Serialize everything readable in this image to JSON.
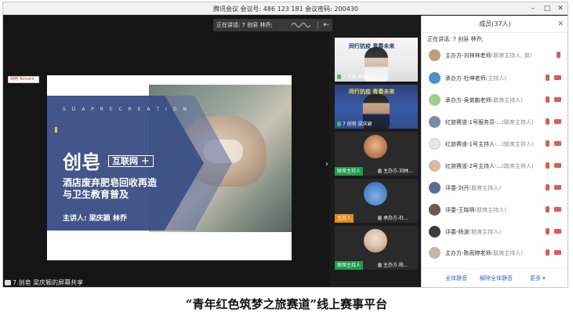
{
  "window": {
    "title": "腾讯会议 会议号: 486 123 181  会议密码: 200430",
    "controls": [
      "–",
      "□",
      "✕"
    ]
  },
  "stage": {
    "speaking": "正在讲话: 7 创皂 林乔;",
    "exit_icon": "exit-icon",
    "mini_logo": "网络 Tencent",
    "share_label": "7.创皂 梁庆颖的屏幕共享"
  },
  "slide": {
    "ribbon": "S D A P R E C R E A T I O N",
    "title": "创皂",
    "tag": "互联网 ＋",
    "subtitle_line1": "酒店废弃肥皂回收再造",
    "subtitle_line2": "与卫生教育普及",
    "speaker": "主讲人: 梁庆颖   林乔",
    "accent_color": "#3a4f86"
  },
  "tiles": [
    {
      "banner": "同行抗疫  青春未来",
      "label": "7 创皂 林乔",
      "mic": "on"
    },
    {
      "banner": "同行抗疫  青春未来",
      "label": "7 创皂 梁庆颖",
      "mic": "on"
    },
    {
      "badge": "联席主持人",
      "badge_color": "green",
      "label": "主办方-刘林...",
      "mic": "off"
    },
    {
      "badge": "主持人",
      "badge_color": "orange",
      "label": "承办方-杜...",
      "mic": "off"
    },
    {
      "badge": "联席主持人",
      "badge_color": "green",
      "label": "主办方-陈...",
      "mic": "off"
    }
  ],
  "sidebar": {
    "title": "成员(37人)",
    "speaking": "正在讲话: 7 创皂 林乔;",
    "members": [
      {
        "name": "主办方-刘林林老师",
        "role": "(联席主持人, 我)",
        "color": "#b9a27a"
      },
      {
        "name": "承办方-杜坤老师",
        "role": "(主持人)",
        "color": "#4f8ed1"
      },
      {
        "name": "承办方-吴弟鹏老师",
        "role": "(联席主持人)",
        "color": "#9fd08a"
      },
      {
        "name": "红旅赛道-1号服务员-...",
        "role": "(联席主持人)",
        "color": "#7b8aa8"
      },
      {
        "name": "红旅赛道-1号主持人-...",
        "role": "(联席主持人)",
        "color": "#e6e6e6"
      },
      {
        "name": "红旅赛道-2号主持人-...",
        "role": "(联席主持人)",
        "color": "#d9b99f"
      },
      {
        "name": "评委-刘丹",
        "role": "(联席主持人)",
        "color": "#5c6e8e"
      },
      {
        "name": "评委-王晓明",
        "role": "(联席主持人)",
        "color": "#6b5b4a"
      },
      {
        "name": "评委-杨波",
        "role": "(联席主持人)",
        "color": "#3d3d3d"
      },
      {
        "name": "主办方-陈雨婷老师",
        "role": "(联席主持人)",
        "color": "#c9b6a6"
      }
    ],
    "footer": {
      "mute_all": "全体静音",
      "unmute_all": "解除全体静音",
      "more": "更多 ▾"
    }
  },
  "caption": "“青年红色筑梦之旅赛道”线上赛事平台"
}
